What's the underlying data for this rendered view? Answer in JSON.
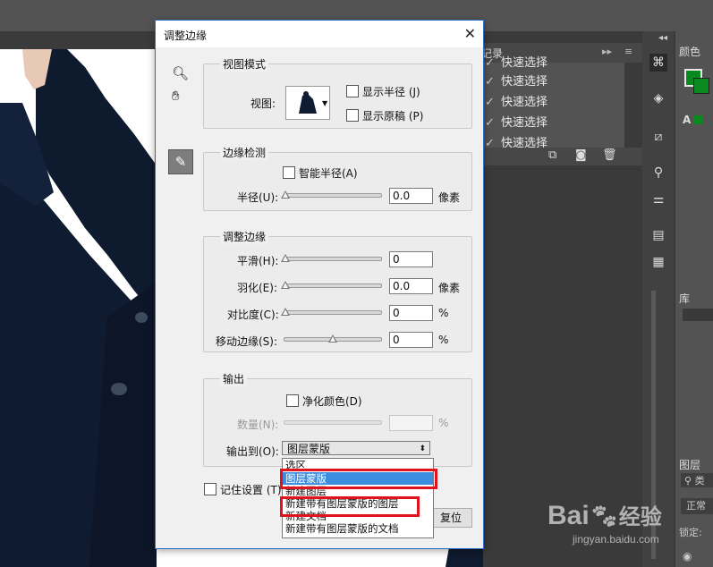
{
  "dialog": {
    "title": "调整边缘",
    "close_glyph": "✕",
    "view_mode": {
      "group_title": "视图模式",
      "view_label": "视图:",
      "show_radius": "显示半径 (J)",
      "show_original": "显示原稿 (P)"
    },
    "edge_detection": {
      "group_title": "边缘检测",
      "smart_radius": "智能半径(A)",
      "radius_label": "半径(U):",
      "radius_value": "0.0",
      "radius_unit": "像素"
    },
    "adjust_edge": {
      "group_title": "调整边缘",
      "smooth_label": "平滑(H):",
      "smooth_value": "0",
      "feather_label": "羽化(E):",
      "feather_value": "0.0",
      "feather_unit": "像素",
      "contrast_label": "对比度(C):",
      "contrast_value": "0",
      "contrast_unit": "%",
      "shift_label": "移动边缘(S):",
      "shift_value": "0",
      "shift_unit": "%"
    },
    "output": {
      "group_title": "输出",
      "decontaminate": "净化颜色(D)",
      "amount_label": "数量(N):",
      "amount_unit": "%",
      "output_to_label": "输出到(O):",
      "output_to_value": "图层蒙版",
      "options": [
        "选区",
        "图层蒙版",
        "新建图层",
        "新建带有图层蒙版的图层",
        "新建文档",
        "新建带有图层蒙版的文档"
      ],
      "selected_option": "图层蒙版"
    },
    "remember": "记住设置 (T)",
    "reset_button": "复位"
  },
  "history_panel": {
    "tab_label": "记录",
    "items": [
      "快速选择",
      "快速选择",
      "快速选择",
      "快速选择",
      "快速选择"
    ]
  },
  "right_panels": {
    "color_tab": "颜色",
    "library_tab": "库",
    "layers_tab": "图层",
    "search_partial": "类",
    "mode_partial": "正常",
    "lock_partial": "锁定:"
  },
  "watermark": {
    "brand": "Bai",
    "brand2": "经验",
    "url": "jingyan.baidu.com"
  },
  "colors": {
    "accent": "#3c8de0",
    "highlight_red": "#e0121b",
    "chrome_dark": "#3a3a3a",
    "dialog_bg": "#f0f0f0"
  }
}
